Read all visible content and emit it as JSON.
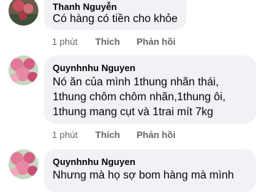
{
  "comments": [
    {
      "author": "Thanh Nguyễn",
      "lines": [
        "Có hàng có tiền cho khỏe"
      ],
      "time": "1 phút",
      "like_label": "Thích",
      "reply_label": "Phản hồi",
      "avatar_icon": "profile-photo-icon"
    },
    {
      "author": "Quynhnhu Nguyen",
      "lines": [
        "Nó ăn của mình 1thung nhãn thái,",
        "1thung chôm chôm nhãn,1thung ôi,",
        "1thung mang cụt và 1trai mít 7kg"
      ],
      "time": "1 phút",
      "like_label": "Thích",
      "reply_label": "Phản hồi",
      "avatar_icon": "profile-photo-icon"
    },
    {
      "author": "Quynhnhu Nguyen",
      "lines": [
        "Nhưng mà họ sợ bom hàng mà mình"
      ],
      "avatar_icon": "profile-photo-icon"
    }
  ],
  "colors": {
    "bubble": "#f0f2f5",
    "secondary_text": "#65676b",
    "primary_text": "#050505"
  }
}
